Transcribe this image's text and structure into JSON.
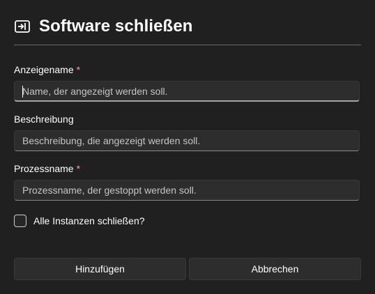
{
  "dialog": {
    "title": "Software schließen",
    "icon": "sign-out-icon"
  },
  "fields": [
    {
      "label": "Anzeigename",
      "required": true,
      "required_marker": "*",
      "value": "",
      "placeholder": "Name, der angezeigt werden soll."
    },
    {
      "label": "Beschreibung",
      "required": false,
      "value": "",
      "placeholder": "Beschreibung, die angezeigt werden soll."
    },
    {
      "label": "Prozessname",
      "required": true,
      "required_marker": "*",
      "value": "",
      "placeholder": "Prozessname, der gestoppt werden soll."
    }
  ],
  "checkbox": {
    "label": "Alle Instanzen schließen?",
    "checked": false
  },
  "buttons": {
    "add_label": "Hinzufügen",
    "cancel_label": "Abbrechen"
  },
  "colors": {
    "background": "#202020",
    "required_marker": "#ff99a4",
    "field_background": "#2d2d2d"
  }
}
